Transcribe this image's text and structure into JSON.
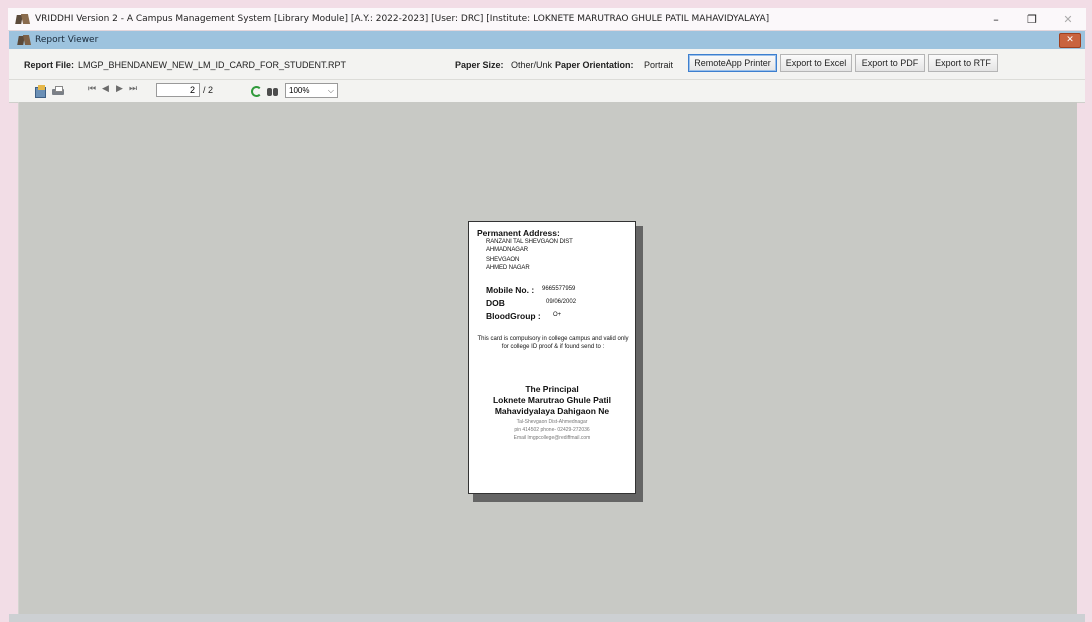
{
  "app": {
    "title": "VRIDDHI Version 2 - A Campus Management System [Library Module] [A.Y.: 2022-2023] [User: DRC] [Institute: LOKNETE MARUTRAO GHULE PATIL MAHAVIDYALAYA]",
    "minimize": "–",
    "maximize": "❐",
    "close": "✕"
  },
  "viewer_window": {
    "title": "Report Viewer",
    "close": "✕"
  },
  "info_bar": {
    "report_file_label": "Report File:",
    "report_file_value": "LMGP_BHENDANEW_NEW_LM_ID_CARD_FOR_STUDENT.RPT",
    "paper_size_label": "Paper Size:",
    "paper_size_value": "Other/Unk",
    "paper_orientation_label": "Paper Orientation:",
    "paper_orientation_value": "Portrait",
    "buttons": {
      "remoteapp_printer": "RemoteApp Printer",
      "export_excel": "Export to Excel",
      "export_pdf": "Export to PDF",
      "export_rtf": "Export to RTF"
    }
  },
  "toolbar": {
    "nav_first": "⏮",
    "nav_prev": "◀",
    "nav_next": "▶",
    "nav_last": "⏭",
    "current_page": "2",
    "page_total": "/ 2",
    "zoom": "100%",
    "zoom_chevron": "⌵",
    "icons": [
      "export-icon",
      "print-icon",
      "refresh-icon",
      "find-icon"
    ]
  },
  "id_card": {
    "address_title": "Permanent Address:",
    "address_lines": [
      "RANZANI TAL SHEVGAON DIST",
      "AHMADNAGAR",
      "SHEVGAON",
      "AHMED NAGAR"
    ],
    "mobile_label": "Mobile No. :",
    "mobile_value": "9665577959",
    "dob_label": "DOB",
    "dob_value": "09/06/2002",
    "blood_label": "BloodGroup :",
    "blood_value": "O+",
    "notice": "This card is compulsory in college campus and valid only for college ID proof & if found send to :",
    "principal_title": "The Principal",
    "principal_line1": "Loknete Marutrao Ghule Patil",
    "principal_line2": "Mahavidyalaya Dahigaon Ne",
    "contact_line1": "Tal-Shevgaon Dist-Ahmednagar",
    "contact_line2": "pin 414502 phone- 02429-272036",
    "contact_line3": "Email lmgpcollege@rediffmail.com"
  }
}
